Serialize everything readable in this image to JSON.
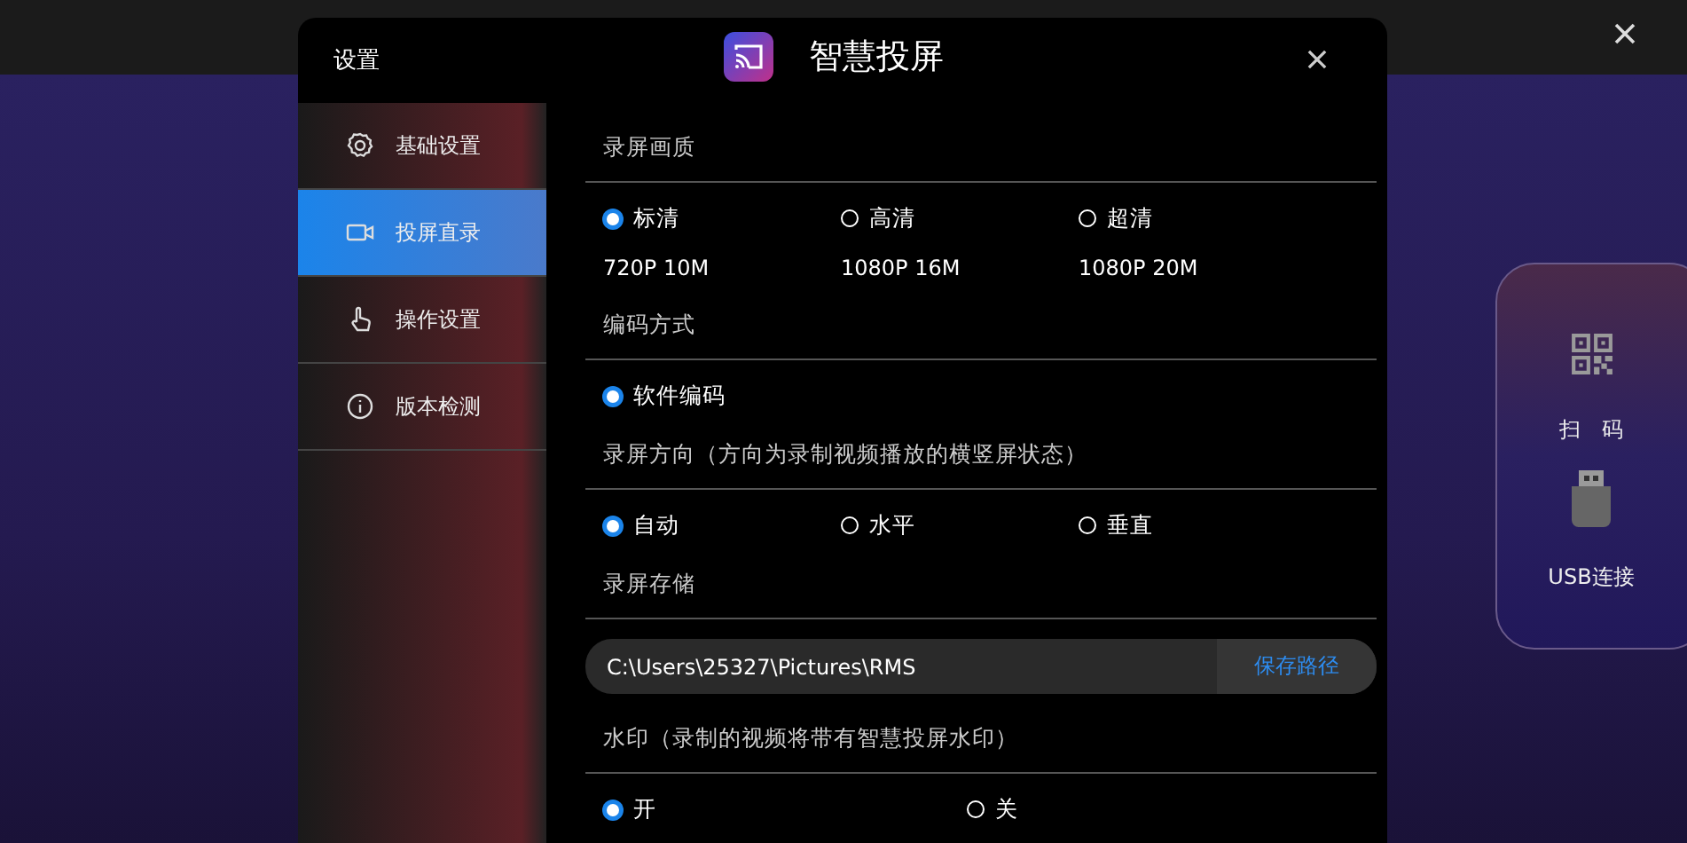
{
  "side_panel": {
    "items": [
      {
        "kind": "qr",
        "label": "扫　码"
      },
      {
        "kind": "usb",
        "label": "USB连接"
      }
    ]
  },
  "window": {
    "title": "设置",
    "app_name": "智慧投屏"
  },
  "sidebar": {
    "items": [
      {
        "kind": "gear",
        "label": "基础设置",
        "selected": false
      },
      {
        "kind": "camera",
        "label": "投屏直录",
        "selected": true
      },
      {
        "kind": "hand",
        "label": "操作设置",
        "selected": false
      },
      {
        "kind": "info",
        "label": "版本检测",
        "selected": false
      }
    ]
  },
  "sections": [
    {
      "kind": "radio",
      "heading": "录屏画质",
      "options": [
        {
          "label": "标清",
          "detail": "720P 10M",
          "selected": true
        },
        {
          "label": "高清",
          "detail": "1080P 16M",
          "selected": false
        },
        {
          "label": "超清",
          "detail": "1080P 20M",
          "selected": false
        }
      ]
    },
    {
      "kind": "radio",
      "heading": "编码方式",
      "options": [
        {
          "label": "软件编码",
          "selected": true
        }
      ]
    },
    {
      "kind": "radio",
      "heading": "录屏方向（方向为录制视频播放的横竖屏状态）",
      "options": [
        {
          "label": "自动",
          "selected": true
        },
        {
          "label": "水平",
          "selected": false
        },
        {
          "label": "垂直",
          "selected": false
        }
      ]
    },
    {
      "kind": "path",
      "heading": "录屏存储",
      "value": "C:\\Users\\25327\\Pictures\\RMS",
      "button": "保存路径"
    },
    {
      "kind": "radio",
      "heading": "水印（录制的视频将带有智慧投屏水印）",
      "options": [
        {
          "label": "开",
          "selected": true
        },
        {
          "label": "关",
          "selected": false
        }
      ]
    }
  ]
}
